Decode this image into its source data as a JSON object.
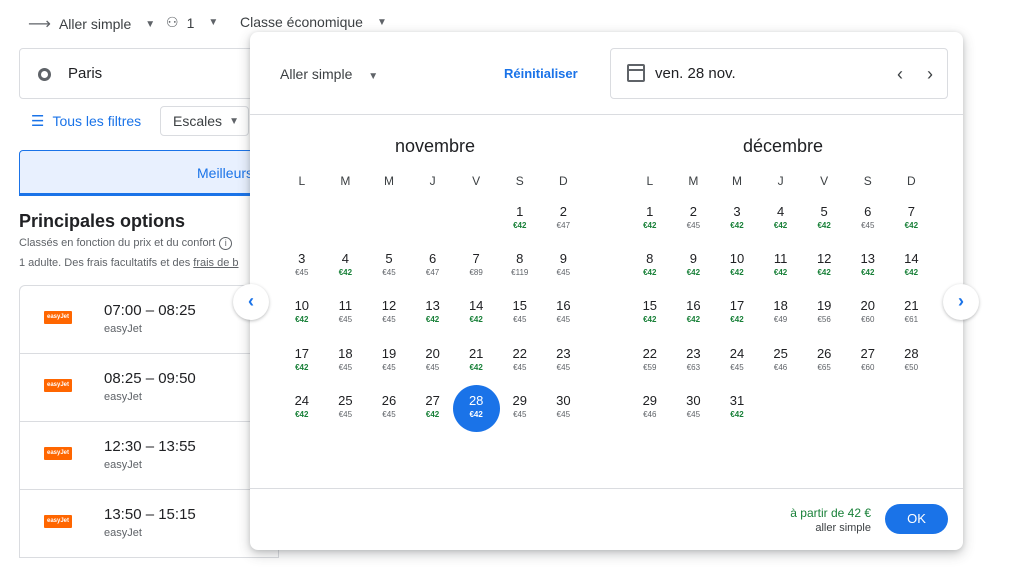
{
  "search": {
    "trip_type": "Aller simple",
    "passengers": "1",
    "cabin": "Classe économique",
    "origin": "Paris",
    "all_filters": "Tous les filtres",
    "stops": "Escales",
    "best_tab": "Meilleurs"
  },
  "results": {
    "title": "Principales options",
    "subtitle": "Classés en fonction du prix et du confort",
    "note": "1 adulte. Des frais facultatifs et des",
    "note_link": "frais de b",
    "flights": [
      {
        "time": "07:00 – 08:25",
        "airline": "easyJet",
        "logo": "easyJet"
      },
      {
        "time": "08:25 – 09:50",
        "airline": "easyJet",
        "logo": "easyJet"
      },
      {
        "time": "12:30 – 13:55",
        "airline": "easyJet",
        "logo": "easyJet"
      },
      {
        "time": "13:50 – 15:15",
        "airline": "easyJet",
        "logo": "easyJet"
      }
    ]
  },
  "picker": {
    "trip_type": "Aller simple",
    "reset": "Réinitialiser",
    "date": "ven. 28 nov.",
    "from_price": "à partir de 42 €",
    "from_sub": "aller simple",
    "ok": "OK",
    "weekdays": [
      "L",
      "M",
      "M",
      "J",
      "V",
      "S",
      "D"
    ],
    "low_color": "#188038",
    "selected_color": "#1a73e8",
    "months": [
      {
        "name": "novembre",
        "offset": 5,
        "days": [
          {
            "d": "1",
            "p": "€42",
            "low": true
          },
          {
            "d": "2",
            "p": "€47"
          },
          {
            "d": "3",
            "p": "€45"
          },
          {
            "d": "4",
            "p": "€42",
            "low": true
          },
          {
            "d": "5",
            "p": "€45"
          },
          {
            "d": "6",
            "p": "€47"
          },
          {
            "d": "7",
            "p": "€89"
          },
          {
            "d": "8",
            "p": "€119"
          },
          {
            "d": "9",
            "p": "€45"
          },
          {
            "d": "10",
            "p": "€42",
            "low": true
          },
          {
            "d": "11",
            "p": "€45"
          },
          {
            "d": "12",
            "p": "€45"
          },
          {
            "d": "13",
            "p": "€42",
            "low": true
          },
          {
            "d": "14",
            "p": "€42",
            "low": true
          },
          {
            "d": "15",
            "p": "€45"
          },
          {
            "d": "16",
            "p": "€45"
          },
          {
            "d": "17",
            "p": "€42",
            "low": true
          },
          {
            "d": "18",
            "p": "€45"
          },
          {
            "d": "19",
            "p": "€45"
          },
          {
            "d": "20",
            "p": "€45"
          },
          {
            "d": "21",
            "p": "€42",
            "low": true
          },
          {
            "d": "22",
            "p": "€45"
          },
          {
            "d": "23",
            "p": "€45"
          },
          {
            "d": "24",
            "p": "€42",
            "low": true
          },
          {
            "d": "25",
            "p": "€45"
          },
          {
            "d": "26",
            "p": "€45"
          },
          {
            "d": "27",
            "p": "€42",
            "low": true
          },
          {
            "d": "28",
            "p": "€42",
            "low": true,
            "selected": true
          },
          {
            "d": "29",
            "p": "€45"
          },
          {
            "d": "30",
            "p": "€45"
          }
        ]
      },
      {
        "name": "décembre",
        "offset": 0,
        "days": [
          {
            "d": "1",
            "p": "€42",
            "low": true
          },
          {
            "d": "2",
            "p": "€45"
          },
          {
            "d": "3",
            "p": "€42",
            "low": true
          },
          {
            "d": "4",
            "p": "€42",
            "low": true
          },
          {
            "d": "5",
            "p": "€42",
            "low": true
          },
          {
            "d": "6",
            "p": "€45"
          },
          {
            "d": "7",
            "p": "€42",
            "low": true
          },
          {
            "d": "8",
            "p": "€42",
            "low": true
          },
          {
            "d": "9",
            "p": "€42",
            "low": true
          },
          {
            "d": "10",
            "p": "€42",
            "low": true
          },
          {
            "d": "11",
            "p": "€42",
            "low": true
          },
          {
            "d": "12",
            "p": "€42",
            "low": true
          },
          {
            "d": "13",
            "p": "€42",
            "low": true
          },
          {
            "d": "14",
            "p": "€42",
            "low": true
          },
          {
            "d": "15",
            "p": "€42",
            "low": true
          },
          {
            "d": "16",
            "p": "€42",
            "low": true
          },
          {
            "d": "17",
            "p": "€42",
            "low": true
          },
          {
            "d": "18",
            "p": "€49"
          },
          {
            "d": "19",
            "p": "€56"
          },
          {
            "d": "20",
            "p": "€60"
          },
          {
            "d": "21",
            "p": "€61"
          },
          {
            "d": "22",
            "p": "€59"
          },
          {
            "d": "23",
            "p": "€63"
          },
          {
            "d": "24",
            "p": "€45"
          },
          {
            "d": "25",
            "p": "€46"
          },
          {
            "d": "26",
            "p": "€65"
          },
          {
            "d": "27",
            "p": "€60"
          },
          {
            "d": "28",
            "p": "€50"
          },
          {
            "d": "29",
            "p": "€46"
          },
          {
            "d": "30",
            "p": "€45"
          },
          {
            "d": "31",
            "p": "€42",
            "low": true
          }
        ]
      }
    ]
  }
}
